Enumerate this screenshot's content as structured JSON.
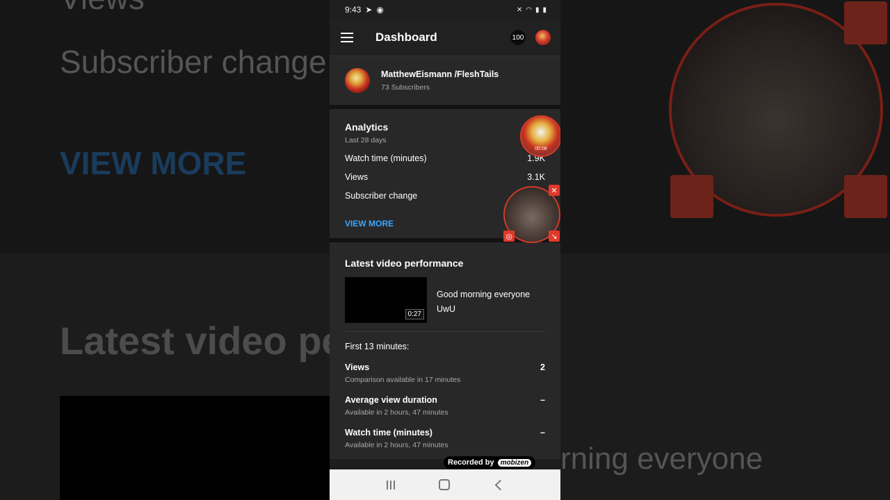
{
  "status": {
    "time": "9:43"
  },
  "appbar": {
    "title": "Dashboard",
    "notifications": "100"
  },
  "channel": {
    "name": "MatthewEismann /FleshTails",
    "subscribers": "73 Subscribers"
  },
  "analytics": {
    "title": "Analytics",
    "period": "Last 28 days",
    "rows": [
      {
        "label": "Watch time (minutes)",
        "value": "1.9K"
      },
      {
        "label": "Views",
        "value": "3.1K"
      },
      {
        "label": "Subscriber change",
        "value": ""
      }
    ],
    "view_more": "VIEW MORE"
  },
  "overlay": {
    "timer": "00:08"
  },
  "latest": {
    "title": "Latest video performance",
    "video_title": "Good morning everyone UwU",
    "duration": "0:27",
    "first_label": "First 13 minutes:",
    "metrics": [
      {
        "label": "Views",
        "value": "2",
        "sub": "Comparison available in 17 minutes"
      },
      {
        "label": "Average view duration",
        "value": "–",
        "sub": "Available in 2 hours, 47 minutes"
      },
      {
        "label": "Watch time (minutes)",
        "value": "–",
        "sub": "Available in 2 hours, 47 minutes"
      }
    ]
  },
  "watermark": {
    "prefix": "Recorded by",
    "brand": "mobizen"
  },
  "background": {
    "line1": "Subscriber change",
    "line2": "VIEW MORE",
    "line3": "Latest video performance",
    "line4": "rning everyone",
    "line0": "Views"
  },
  "colors": {
    "accent": "#3ea6ff",
    "bubble_red": "#e0392b",
    "surface": "#282828"
  }
}
